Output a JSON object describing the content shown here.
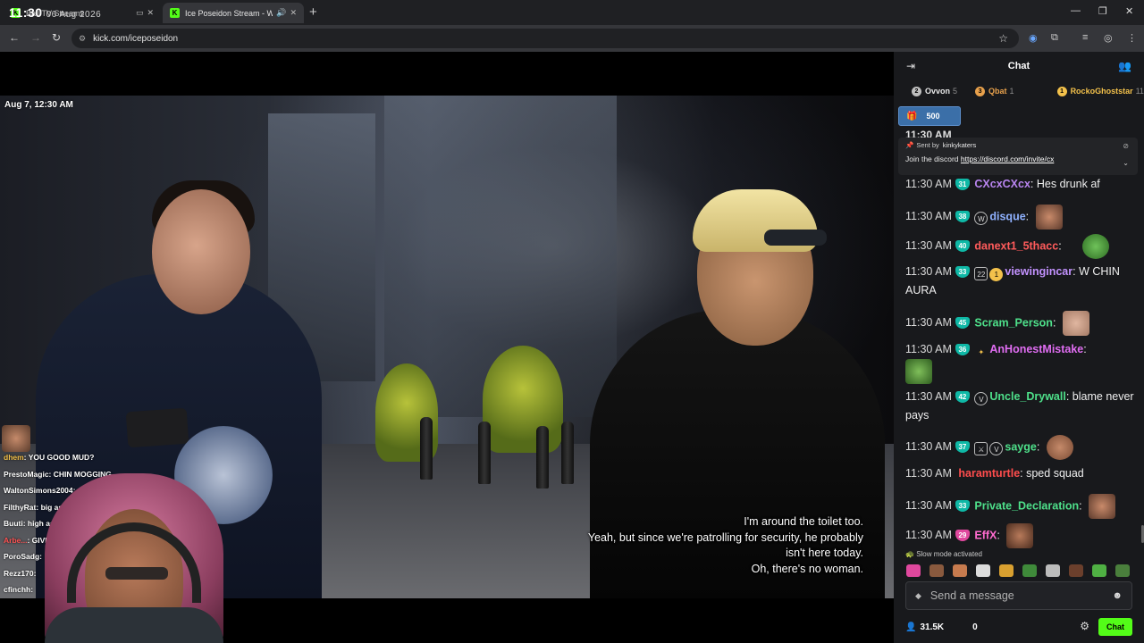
{
  "clock": {
    "time": "11:30",
    "date": "06 Aug 2026"
  },
  "tabs": [
    {
      "title": "Ball/TV Streams",
      "favicon": "K"
    },
    {
      "title": "Ice Poseidon Stream - Watc",
      "favicon": "K"
    }
  ],
  "addressbar": {
    "url": "kick.com/iceposeidon"
  },
  "video": {
    "timestamp": "Aug 7, 12:30 AM",
    "subtitles": [
      "I'm around the toilet too.",
      "Yeah, but since we're patrolling for security, he probably",
      "isn't here today.",
      "Oh, there's no woman."
    ],
    "overlay_chat": [
      {
        "user": "dhem",
        "text": "YOU GOOD MUD?",
        "color": "#f3c14b"
      },
      {
        "user": "PrestoMagic",
        "text": "CHIN MOGGING",
        "color": "#ffffff"
      },
      {
        "user": "WaltonSimons2004",
        "text": "",
        "color": "#ffffff"
      },
      {
        "user": "FilthyRat",
        "text": "big as",
        "color": "#ffffff"
      },
      {
        "user": "Buuti",
        "text": "high asf",
        "color": "#ffffff"
      },
      {
        "user": "Arbe...",
        "text": "GIVE",
        "color": "#ff5555"
      },
      {
        "user": "PoroSadg",
        "text": "",
        "color": "#ffffff"
      },
      {
        "user": "Rezz170",
        "text": "",
        "color": "#ffffff"
      },
      {
        "user": "cfinchh",
        "text": "",
        "color": "#ffffff"
      }
    ]
  },
  "chat": {
    "title": "Chat",
    "leaderboard": [
      {
        "rank": "2",
        "name": "Ovvon",
        "count": "5",
        "color": "#bfbfbf"
      },
      {
        "rank": "3",
        "name": "Qbat",
        "count": "1",
        "color": "#e8a14c"
      },
      {
        "rank": "1",
        "name": "RockoGhoststar",
        "count": "11",
        "color": "#f3c14b"
      }
    ],
    "pinned_gift": {
      "amount": "500"
    },
    "hidden_line": "11:30 AM",
    "pinned_message": {
      "label": "Sent by",
      "sender": "kinkykaters",
      "text": "Join the discord",
      "link": "https://discord.com/invite/cx"
    },
    "messages": [
      {
        "time": "11:30 AM",
        "sub": "31",
        "user": "CXcxCXcx",
        "color": "#b985f0",
        "text": "Hes drunk af"
      },
      {
        "time": "11:30 AM",
        "sub": "38",
        "user": "disque",
        "color": "#8fb1ff",
        "text": ""
      },
      {
        "time": "11:30 AM",
        "sub": "40",
        "user": "danext1_5thacc",
        "color": "#ff5b5b",
        "text": ""
      },
      {
        "time": "11:30 AM",
        "sub": "33",
        "user": "viewingincar",
        "color": "#c392ff",
        "text": "W CHIN AURA"
      },
      {
        "time": "11:30 AM",
        "sub": "45",
        "user": "Scram_Person",
        "color": "#4ee08a",
        "text": ""
      },
      {
        "time": "11:30 AM",
        "sub": "36",
        "user": "AnHonestMistake",
        "color": "#e06df2",
        "text": ""
      },
      {
        "time": "11:30 AM",
        "sub": "42",
        "user": "Uncle_Drywall",
        "color": "#4ee08a",
        "text": "blame never pays"
      },
      {
        "time": "11:30 AM",
        "sub": "37",
        "user": "sayge",
        "color": "#4ee08a",
        "text": ""
      },
      {
        "time": "11:30 AM",
        "sub": "",
        "user": "haramturtle",
        "color": "#ff4d4d",
        "text": "sped squad"
      },
      {
        "time": "11:30 AM",
        "sub": "33",
        "user": "Private_Declaration",
        "color": "#4ee08a",
        "text": ""
      },
      {
        "time": "11:30 AM",
        "sub": "29",
        "user": "EffX",
        "color": "#ff6bcf",
        "text": ""
      }
    ],
    "slow_mode": "Slow mode activated",
    "input_placeholder": "Send a message",
    "viewers": "31.5K",
    "points": "0",
    "send_label": "Chat"
  },
  "colors": {
    "kick_green": "#53fc18",
    "chat_bg": "#18191c",
    "sub_badge": "#0fb8a6"
  }
}
